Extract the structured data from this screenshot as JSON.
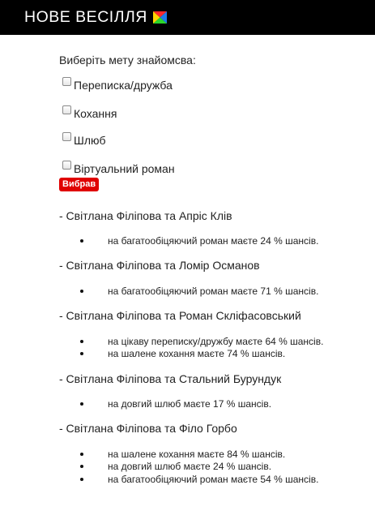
{
  "header": {
    "title": "НОВЕ ВЕСІЛЛЯ"
  },
  "form": {
    "prompt": "Виберіть мету знайомсва:",
    "options": [
      "Переписка/дружба",
      "Кохання",
      "Шлюб",
      "Віртуальний роман"
    ],
    "submit_label": "Вибрав"
  },
  "results": [
    {
      "pair": "- Світлана Філіпова та Апріс Клів",
      "items": [
        "на багатообіцяючий роман маєте 24 % шансів."
      ]
    },
    {
      "pair": "- Світлана Філіпова та Ломір Османов",
      "items": [
        "на багатообіцяючий роман маєте 71 % шансів."
      ]
    },
    {
      "pair": "- Світлана Філіпова та Роман Скліфасовський",
      "items": [
        "на цікаву переписку/дружбу маєте 64 % шансів.",
        "на шалене кохання маєте 74 % шансів."
      ]
    },
    {
      "pair": "- Світлана Філіпова та Стальний Бурундук",
      "items": [
        "на довгий шлюб маєте 17 % шансів."
      ]
    },
    {
      "pair": "- Світлана Філіпова та Філо Горбо",
      "items": [
        "на шалене кохання маєте 84 % шансів.",
        "на довгий шлюб маєте 24 % шансів.",
        "на багатообіцяючий роман маєте 54 % шансів."
      ]
    }
  ],
  "colors": {
    "header_bg": "#000000",
    "button_bg": "#e00000"
  }
}
